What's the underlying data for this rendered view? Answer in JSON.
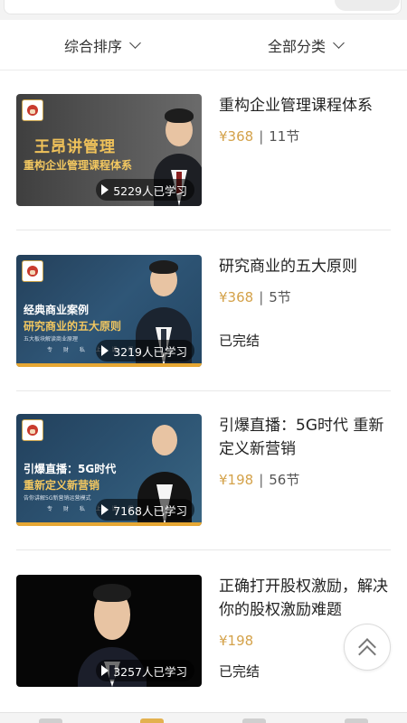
{
  "filters": {
    "sort_label": "综合排序",
    "category_label": "全部分类"
  },
  "courses": [
    {
      "title": "重构企业管理课程体系",
      "price": "¥368",
      "lessons": "11节",
      "learners": "5229人已学习",
      "status": "",
      "thumb_title": "王昂讲管理",
      "thumb_subtitle": "重构企业管理课程体系"
    },
    {
      "title": "研究商业的五大原则",
      "price": "¥368",
      "lessons": "5节",
      "learners": "3219人已学习",
      "status": "已完结",
      "thumb_title": "经典商业案例",
      "thumb_subtitle": "研究商业的五大原则",
      "thumb_note": "五大板块解读商业原理",
      "thumb_footer": "专 财 私 上 课 程"
    },
    {
      "title": "引爆直播：5G时代 重新定义新营销",
      "price": "¥198",
      "lessons": "56节",
      "learners": "7168人已学习",
      "status": "",
      "thumb_title": "引爆直播：5G时代",
      "thumb_subtitle": "重新定义新营销",
      "thumb_note": "告你讲解5G新营销运营模式",
      "thumb_footer": "专 财 私 上 课 程"
    },
    {
      "title": "正确打开股权激励，解决你的股权激励难题",
      "price": "¥198",
      "lessons": "",
      "learners": "3257人已学习",
      "status": "已完结"
    }
  ],
  "icons": {
    "sort_chevron": "chevron-down-icon",
    "category_chevron": "chevron-down-icon",
    "play": "play-icon",
    "scroll_top": "double-chevron-up-icon"
  },
  "colors": {
    "price": "#d4a24a",
    "accent": "#e6a733"
  }
}
